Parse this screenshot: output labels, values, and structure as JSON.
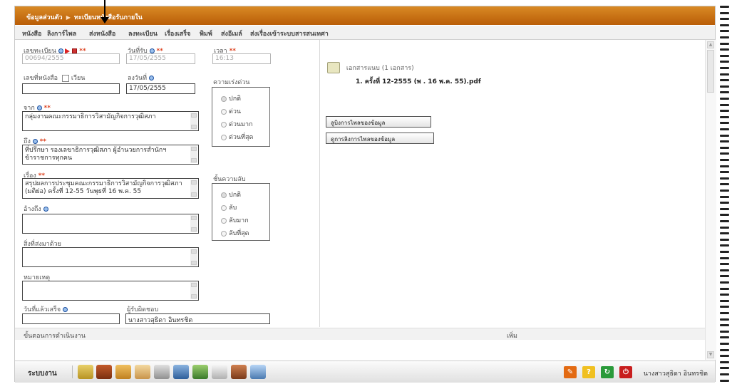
{
  "title_bar": {
    "part1": "ข้อมูลส่วนตัว",
    "part2": "ทะเบียนหนังสือรับภายใน"
  },
  "menu": [
    "หนังสือ",
    "ลิงการ์ไพล",
    "ส่งหนังสือ",
    "ลงทะเบียน",
    "เรื่องเสร็จ",
    "พิมพ์",
    "ส่งอีเมล์",
    "ส่งเรื่องเข้าระบบสารสนเทศา"
  ],
  "form": {
    "reg_no_label": "เลขทะเบียน",
    "reg_no_value": "00694/2555",
    "received_date_label": "วันที่รับ",
    "received_date_value": "17/05/2555",
    "time_label": "เวลา",
    "time_value": "16:13",
    "book_no_label": "เลขที่หนังสือ",
    "circular_label": "เวียน",
    "book_no_value": "",
    "dated_label": "ลงวันที่",
    "dated_value": "17/05/2555",
    "urgency_label": "ความเร่งด่วน",
    "urgency_options": [
      "ปกติ",
      "ด่วน",
      "ด่วนมาก",
      "ด่วนที่สุด"
    ],
    "from_label": "จาก",
    "from_value": "กลุ่มงานคณะกรรมาธิการวิสามัญกิจการวุฒิสภา",
    "to_label": "ถึง",
    "to_value": "ที่ปรึกษา รองเลขาธิการวุฒิสภา ผู้อำนวยการสำนักฯ ข้าราชการทุกคน",
    "subject_label": "เรื่อง",
    "subject_value": "สรุปผลการประชุมคณะกรรมาธิการวิสามัญกิจการวุฒิสภา (มติย่อ) ครั้งที่ 12-55  วันพุธที่ 16 พ.ค. 55",
    "secrecy_label": "ชั้นความลับ",
    "secrecy_options": [
      "ปกติ",
      "ลับ",
      "ลับมาก",
      "ลับที่สุด"
    ],
    "reference_label": "อ้างถึง",
    "enclosure_label": "สิ่งที่ส่งมาด้วย",
    "note_label": "หมายเหตุ",
    "due_date_label": "วันที่แล้วเสร็จ",
    "responsible_label": "ผู้รับผิดชอบ",
    "responsible_value": "นางสาวสุธิดา  อินทรชิต",
    "required_mark": "**"
  },
  "attachments": {
    "header": "เอกสารแนบ (1 เอกสาร)",
    "items": [
      "1. ครั้งที่ 12-2555 (พ . 16 พ.ค. 55).pdf"
    ],
    "add_button": "ลูบิงการไพลของข้อมูล",
    "manage_button": "ดูการลิงการไพลของข้อมูล"
  },
  "steps_bar": {
    "label": "ขั้นตอนการดำเนินงาน",
    "add": "เพิ่ม"
  },
  "taskbar": {
    "label": "ระบบงาน",
    "user": "นางสาวสุธิดา อินทรชิต"
  },
  "colors": {
    "title_bar": "#c96d12",
    "required": "#dd4422",
    "icon_blue": "#1a4fa0"
  }
}
